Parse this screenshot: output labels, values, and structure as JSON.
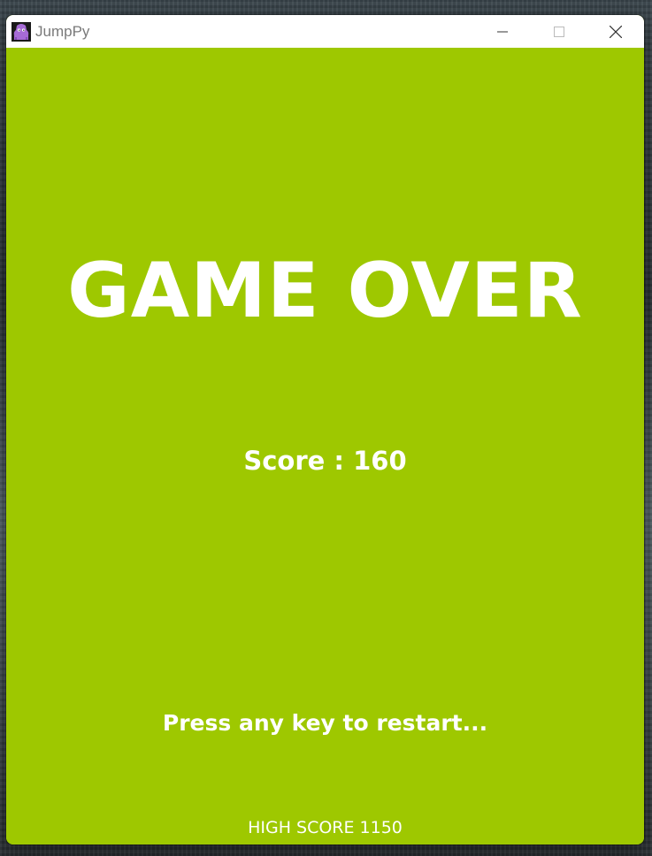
{
  "window": {
    "title": "JumpPy",
    "icon": "purple-jumper-icon"
  },
  "controls": {
    "minimize_icon": "minimize-icon",
    "maximize_icon": "maximize-icon",
    "close_icon": "close-icon"
  },
  "game": {
    "background_color": "#9ec800",
    "headline": "GAME OVER",
    "score_text": "Score : 160",
    "prompt": "Press any key to restart...",
    "high_score_text": "HIGH SCORE 1150"
  }
}
